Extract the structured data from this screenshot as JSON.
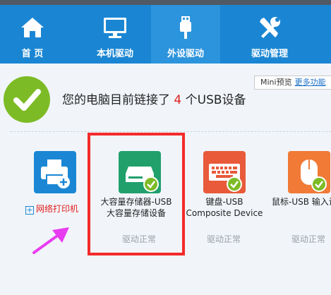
{
  "nav": {
    "tabs": [
      {
        "label": "首 页",
        "icon": "home-icon"
      },
      {
        "label": "本机驱动",
        "icon": "monitor-icon"
      },
      {
        "label": "外设驱动",
        "icon": "usb-icon"
      },
      {
        "label": "驱动管理",
        "icon": "tools-icon"
      }
    ],
    "active_tab": "外设驱动"
  },
  "tooltip": {
    "text": "Mini预览",
    "link": "更多功能"
  },
  "status": {
    "prefix": "您的电脑目前链接了",
    "count": "4",
    "suffix": "个USB设备"
  },
  "devices": [
    {
      "name": "网络打印机",
      "icon": "printer-icon",
      "add_symbol": "+"
    },
    {
      "name_line1": "大容量存储器-USB",
      "name_line2": "大容量存储设备",
      "state": "驱动正常",
      "icon": "storage-drive-icon"
    },
    {
      "name_line1": "键盘-USB",
      "name_line2": "Composite Device",
      "state": "驱动正常",
      "icon": "keyboard-icon"
    },
    {
      "name_line1": "鼠标-USB 输入设",
      "state": "驱动正常",
      "icon": "mouse-icon"
    }
  ],
  "colors": {
    "nav_bg": "#1a86d3",
    "ok_green": "#7dbb26",
    "highlight_red": "#f42b2b",
    "count_red": "#e02020"
  }
}
